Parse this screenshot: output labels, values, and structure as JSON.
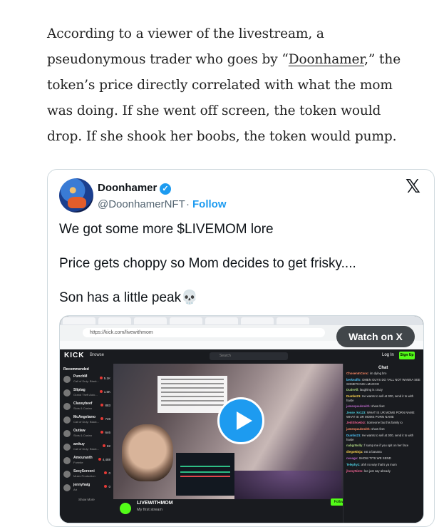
{
  "article": {
    "paragraph_prefix": "According to a viewer of the livestream, a pseudonymous trader who goes by “",
    "link_text": "Doonhamer",
    "paragraph_suffix": ",” the token’s price directly correlated with what the mom was doing. If she went off screen, the token would drop. If she shook her boobs, the token would pump."
  },
  "tweet": {
    "display_name": "Doonhamer",
    "verified_icon": "✓",
    "handle": "@DoonhamerNFT",
    "separator": "·",
    "follow_label": "Follow",
    "x_logo": "𝕏",
    "lines": [
      "We got some more $LIVEMOM lore",
      "Price gets choppy so Mom decides to get frisky....",
      "Son has a little peak💀"
    ],
    "watch_label": "Watch on X"
  },
  "embedded_screen": {
    "url_text": "https://kick.com/livewithmom",
    "kick_logo": "KICK",
    "browse_label": "Browse",
    "search_placeholder": "Search",
    "login_label": "Log In",
    "signup_label": "Sign Up",
    "sidebar_heading": "Recommended",
    "sidebar_items": [
      {
        "name": "PunchM",
        "game": "Call of Duty: Black...",
        "count": "5.1K"
      },
      {
        "name": "Sliptag",
        "game": "Grand Theft Auto...",
        "count": "1.5K"
      },
      {
        "name": "Classybeef",
        "game": "Slots & Casino",
        "count": "883"
      },
      {
        "name": "McAngelamo",
        "game": "Call of Duty: Black...",
        "count": "728"
      },
      {
        "name": "Outlaw",
        "game": "Slots & Casino",
        "count": "646"
      },
      {
        "name": "amkuy",
        "game": "Call of Duty: Black...",
        "count": "82"
      },
      {
        "name": "Amouranth",
        "game": "Fortnite",
        "count": "4,488"
      },
      {
        "name": "SexySereeni",
        "game": "Music Production",
        "count": "0"
      },
      {
        "name": "jennyhaig",
        "game": "Art",
        "count": "0"
      }
    ],
    "show_more": "Show More",
    "streamer_name": "LIVEWITHMOM",
    "stream_title": "My first stream",
    "follow_small": "Follow",
    "chat_heading": "Chat",
    "chat_lines": [
      {
        "user": "ChosenInConc:",
        "msg": "im dying bro"
      },
      {
        "user": "berkeaffo:",
        "msg": "OMEN GUYS DO YALL NOT WANNA SEE SOMETHING LMAOOO"
      },
      {
        "user": "DudeAll:",
        "msg": "laughing is crazy"
      },
      {
        "user": "Dumb421:",
        "msg": "He wants to sell at 300, send it to with haste"
      },
      {
        "user": "jamespaulsmith:",
        "msg": "show feet"
      },
      {
        "user": "Jesse_kv123:",
        "msg": "WHAT IS UR MOMS PORN NAME WHAT IS UR MOMS PORN NAME"
      },
      {
        "user": "JediShowbiz:",
        "msg": "Someone fax this family io"
      },
      {
        "user": "jamespaulsmith:",
        "msg": "show feet"
      },
      {
        "user": "Dumb421:",
        "msg": "He wants to sell at 300, send it to with haste"
      },
      {
        "user": "nabgrNolly:",
        "msg": "f sump me if you spit on her face"
      },
      {
        "user": "diegoNinja:",
        "msg": "eat a banana"
      },
      {
        "user": "neoage:",
        "msg": "SHOW TITS WE SEND"
      },
      {
        "user": "Telephy1:",
        "msg": "ahh no way that's ya mum"
      },
      {
        "user": "jhonyNinto:",
        "msg": "lee just say already"
      }
    ]
  },
  "colors": {
    "link_blue": "#1d9bf0",
    "kick_green": "#53fc18",
    "dark_bg": "#191b1f"
  }
}
